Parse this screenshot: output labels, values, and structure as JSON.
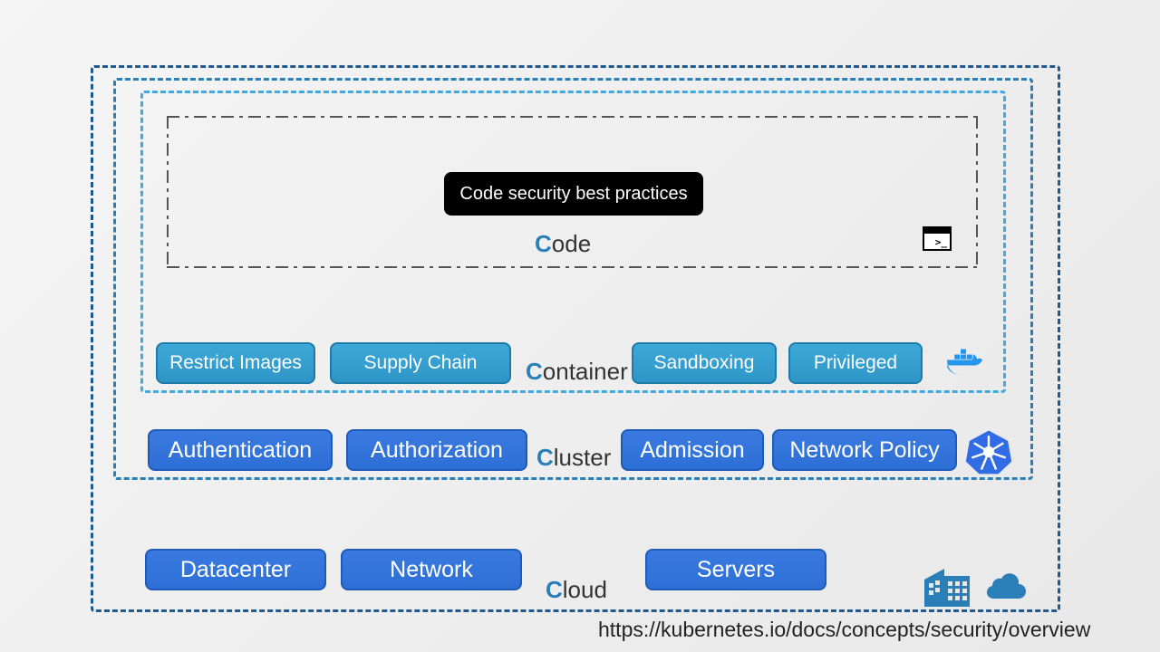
{
  "layers": {
    "code": {
      "label_first": "C",
      "label_rest": "ode"
    },
    "container": {
      "label_first": "C",
      "label_rest": "ontainer"
    },
    "cluster": {
      "label_first": "C",
      "label_rest": "luster"
    },
    "cloud": {
      "label_first": "C",
      "label_rest": "loud"
    }
  },
  "code_pill": "Code security best practices",
  "container_items": [
    "Restrict Images",
    "Supply Chain",
    "Sandboxing",
    "Privileged"
  ],
  "cluster_items": [
    "Authentication",
    "Authorization",
    "Admission",
    "Network Policy"
  ],
  "cloud_items": [
    "Datacenter",
    "Network",
    "Servers"
  ],
  "source_url": "https://kubernetes.io/docs/concepts/security/overview",
  "icons": {
    "terminal": "terminal-icon",
    "docker": "docker-icon",
    "kubernetes": "kubernetes-icon",
    "building": "building-icon",
    "cloud": "cloud-icon"
  }
}
